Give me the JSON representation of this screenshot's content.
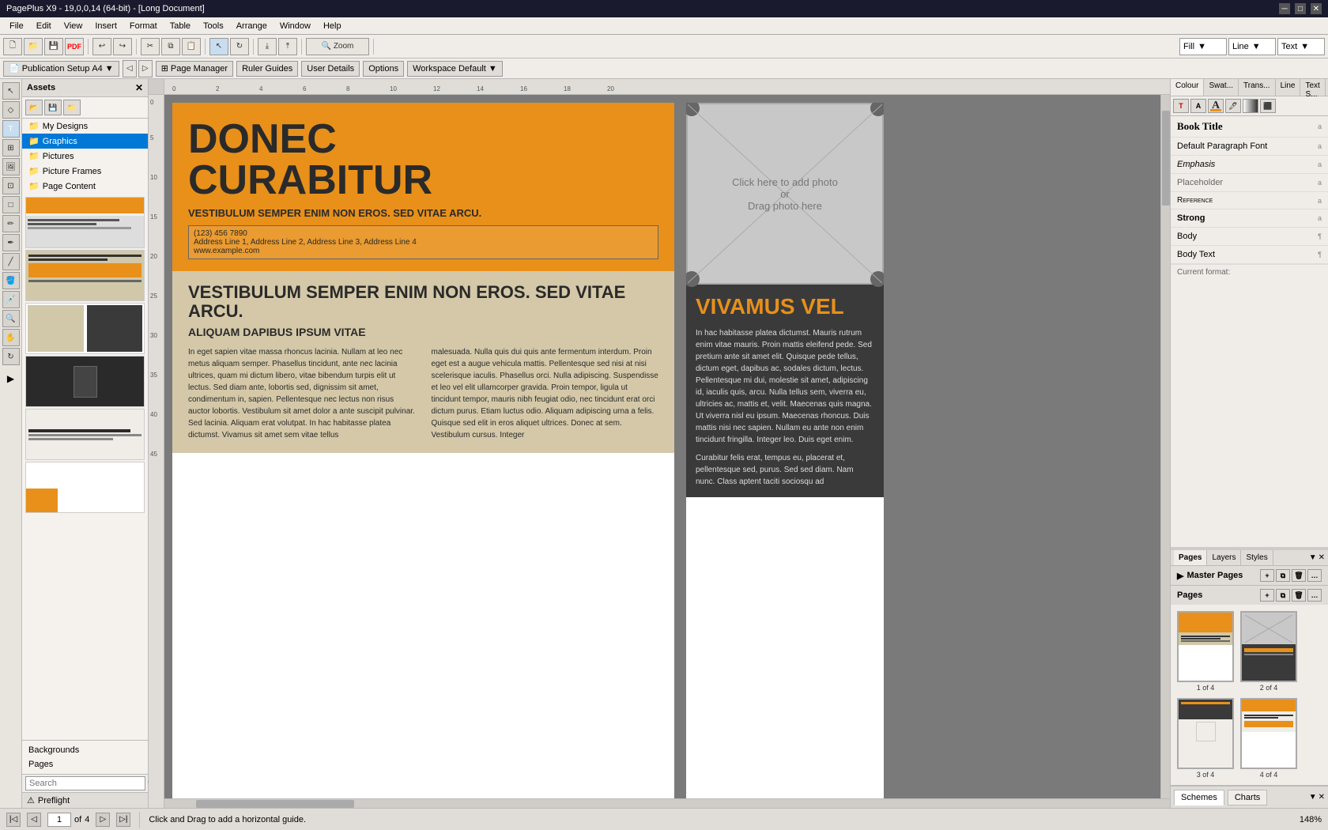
{
  "app": {
    "title": "PagePlus X9 - 19,0,0,14 (64-bit) - [Long Document]",
    "window_controls": [
      "minimize",
      "maximize",
      "close"
    ]
  },
  "menubar": {
    "items": [
      "File",
      "Edit",
      "View",
      "Insert",
      "Format",
      "Table",
      "Tools",
      "Arrange",
      "Window",
      "Help"
    ]
  },
  "toolbar": {
    "fill_label": "Fill",
    "line_label": "Line",
    "text_label": "Text"
  },
  "pubbar": {
    "setup_label": "Publication Setup",
    "paper_size": "A4",
    "page_manager_label": "Page Manager",
    "ruler_guides_label": "Ruler Guides",
    "user_details_label": "User Details",
    "options_label": "Options",
    "workspace_label": "Workspace Default"
  },
  "assets": {
    "panel_title": "Assets",
    "toolbar_buttons": [
      "browse",
      "save",
      "folder"
    ],
    "items": [
      {
        "label": "My Designs",
        "icon": "folder"
      },
      {
        "label": "Graphics",
        "icon": "folder",
        "selected": true
      },
      {
        "label": "Pictures",
        "icon": "folder"
      },
      {
        "label": "Picture Frames",
        "icon": "folder"
      },
      {
        "label": "Page Content",
        "icon": "folder"
      }
    ],
    "footer": {
      "backgrounds_label": "Backgrounds",
      "pages_label": "Pages",
      "preflight_label": "Preflight"
    },
    "search_placeholder": "Search"
  },
  "canvas": {
    "page1": {
      "header": {
        "bg_color": "#e8901a",
        "title_line1": "DONEC",
        "title_line2": "CURABITUR",
        "subtitle": "VESTIBULUM SEMPER ENIM NON EROS. SED VITAE ARCU.",
        "address_line1": "(123) 456 7890",
        "address_line2": "Address Line 1, Address Line 2, Address Line 3, Address Line 4",
        "address_line3": "www.example.com"
      },
      "body": {
        "heading": "VESTIBULUM SEMPER ENIM NON EROS. SED VITAE ARCU.",
        "subheading": "ALIQUAM DAPIBUS IPSUM VITAE",
        "col1_text": "In eget sapien vitae massa rhoncus lacinia. Nullam at leo nec metus aliquam semper. Phasellus tincidunt, ante nec lacinia ultrices, quam mi dictum libero, vitae bibendum turpis elit ut lectus. Sed diam ante, lobortis sed, dignissim sit amet, condimentum in, sapien. Pellentesque nec lectus non risus auctor lobortis. Vestibulum sit amet dolor a ante suscipit pulvinar. Sed lacinia. Aliquam erat volutpat. In hac habitasse platea dictumst. Vivamus sit amet sem vitae tellus",
        "col2_text": "malesuada. Nulla quis dui quis ante fermentum interdum. Proin eget est a augue vehicula mattis. Pellentesque sed nisi at nisi scelerisque iaculis. Phasellus orci. Nulla adipiscing. Suspendisse et leo vel elit ullamcorper gravida. Proin tempor, ligula ut tincidunt tempor, mauris nibh feugiat odio, nec tincidunt erat orci dictum purus. Etiam luctus odio. Aliquam adipiscing urna a felis. Quisque sed elit in eros aliquet ultrices. Donec at sem. Vestibulum cursus. Integer"
      }
    },
    "page2": {
      "photo_text1": "Click here to add photo",
      "photo_text2": "or",
      "photo_text3": "Drag photo here",
      "body_title": "VIVAMUS VEL",
      "body_text1": "In hac habitasse platea dictumst. Mauris rutrum enim vitae mauris. Proin mattis eleifend pede. Sed pretium ante sit amet elit. Quisque pede tellus, dictum eget, dapibus ac, sodales dictum, lectus. Pellentesque mi dui, molestie sit amet, adipiscing id, iaculis quis, arcu. Nulla tellus sem, viverra eu, ultricies ac, mattis et, velit. Maecenas quis magna. Ut viverra nisl eu ipsum. Maecenas rhoncus. Duis mattis nisi nec sapien. Nullam eu ante non enim tincidunt fringilla. Integer leo. Duis eget enim.",
      "body_text2": "Curabitur felis erat, tempus eu, placerat et, pellentesque sed, purus. Sed sed diam. Nam nunc. Class aptent taciti sociosqu ad"
    }
  },
  "right_panel": {
    "color_tabs": [
      "Colour",
      "Swat...",
      "Trans...",
      "Line",
      "Text S..."
    ],
    "color_toolbar_items": [
      "T",
      "A",
      "swash",
      "color1",
      "color2",
      "color3"
    ],
    "text_styles": {
      "title": "Text Styles",
      "items": [
        {
          "label": "Book Title",
          "marker": "a",
          "style": "book-title"
        },
        {
          "label": "Default Paragraph Font",
          "marker": "a",
          "style": "default"
        },
        {
          "label": "Emphasis",
          "marker": "a",
          "style": "emphasis"
        },
        {
          "label": "Placeholder",
          "marker": "a",
          "style": "placeholder"
        },
        {
          "label": "Reference",
          "marker": "a",
          "style": "reference"
        },
        {
          "label": "Strong",
          "marker": "a",
          "style": "strong"
        },
        {
          "label": "Body",
          "marker": "¶",
          "style": "body"
        },
        {
          "label": "Body Text",
          "marker": "¶",
          "style": "body-text"
        }
      ],
      "current_format_label": "Current format:"
    }
  },
  "pages_panel": {
    "tabs": [
      "Pages",
      "Layers",
      "Styles"
    ],
    "master_pages_label": "Master Pages",
    "pages_label": "Pages",
    "pages": [
      {
        "label": "1 of 4",
        "selected": false
      },
      {
        "label": "2 of 4",
        "selected": false
      },
      {
        "label": "3 of 4",
        "selected": false
      },
      {
        "label": "4 of 4",
        "selected": false
      }
    ],
    "bottom_tabs": [
      "Schemes",
      "Charts"
    ]
  },
  "statusbar": {
    "page_current": "1",
    "page_total": "4",
    "of_label": "of",
    "hint_text": "Click and Drag to add a horizontal guide.",
    "zoom_level": "148%",
    "preflight_label": "Preflight"
  }
}
